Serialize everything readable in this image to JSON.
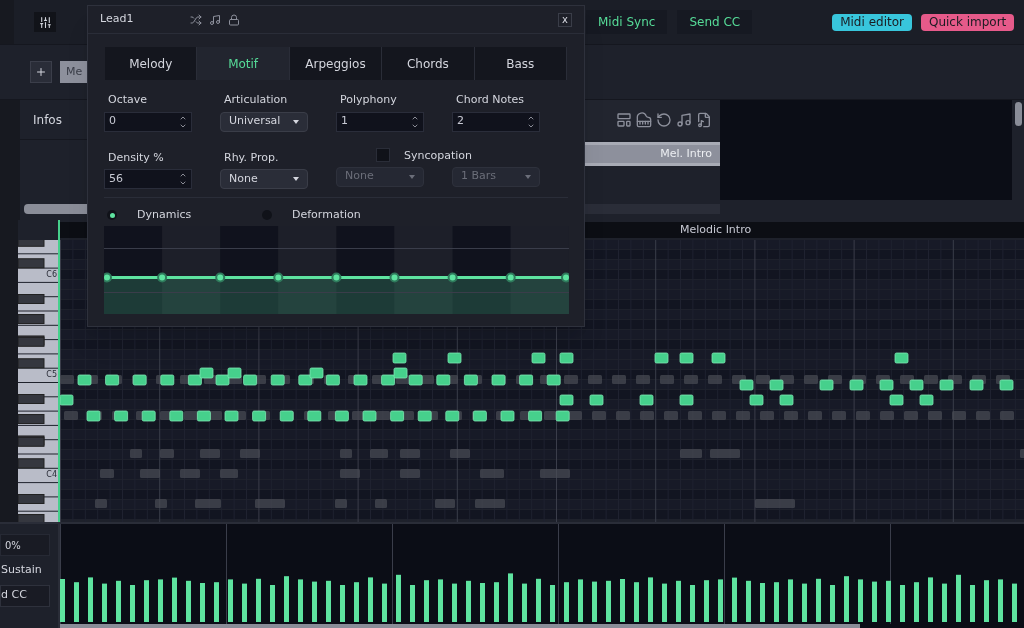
{
  "toolbar": {
    "buttons": [
      {
        "label": "Midi Sync"
      },
      {
        "label": "Send CC"
      }
    ],
    "badges": [
      {
        "label": "Midi editor",
        "color": "#38c6dc"
      },
      {
        "label": "Quick import",
        "color": "#e65a8a"
      }
    ]
  },
  "track_tab": "Me",
  "infos_label": "Infos",
  "clip": "Mel. Intro",
  "piano_roll": {
    "section": "Melodic Intro",
    "key_labels": [
      "C6",
      "C5",
      "C4"
    ]
  },
  "lane": {
    "value": "0%",
    "label": "Sustain",
    "button": "d CC"
  },
  "dialog": {
    "title": "Lead1",
    "close": "x",
    "tabs": [
      {
        "label": "Melody",
        "selected": false
      },
      {
        "label": "Motif",
        "selected": true
      },
      {
        "label": "Arpeggios",
        "selected": false
      },
      {
        "label": "Chords",
        "selected": false
      },
      {
        "label": "Bass",
        "selected": false
      }
    ],
    "row_1": [
      {
        "label": "Octave",
        "kind": "spin",
        "value": "0"
      },
      {
        "label": "Articulation",
        "kind": "select",
        "value": "Universal"
      },
      {
        "label": "Polyphony",
        "kind": "spin",
        "value": "1"
      },
      {
        "label": "Chord Notes",
        "kind": "spin",
        "value": "2"
      }
    ],
    "row_2": [
      {
        "label": "Density %",
        "kind": "spin",
        "value": "56"
      },
      {
        "label": "Rhy. Prop.",
        "kind": "select",
        "value": "None"
      }
    ],
    "syncopation": {
      "label": "Syncopation",
      "checked": false,
      "options": [
        {
          "value": "None",
          "disabled": true
        },
        {
          "value": "1 Bars",
          "disabled": true
        }
      ]
    },
    "modes": [
      {
        "label": "Dynamics",
        "selected": true
      },
      {
        "label": "Deformation",
        "selected": false
      }
    ]
  }
}
